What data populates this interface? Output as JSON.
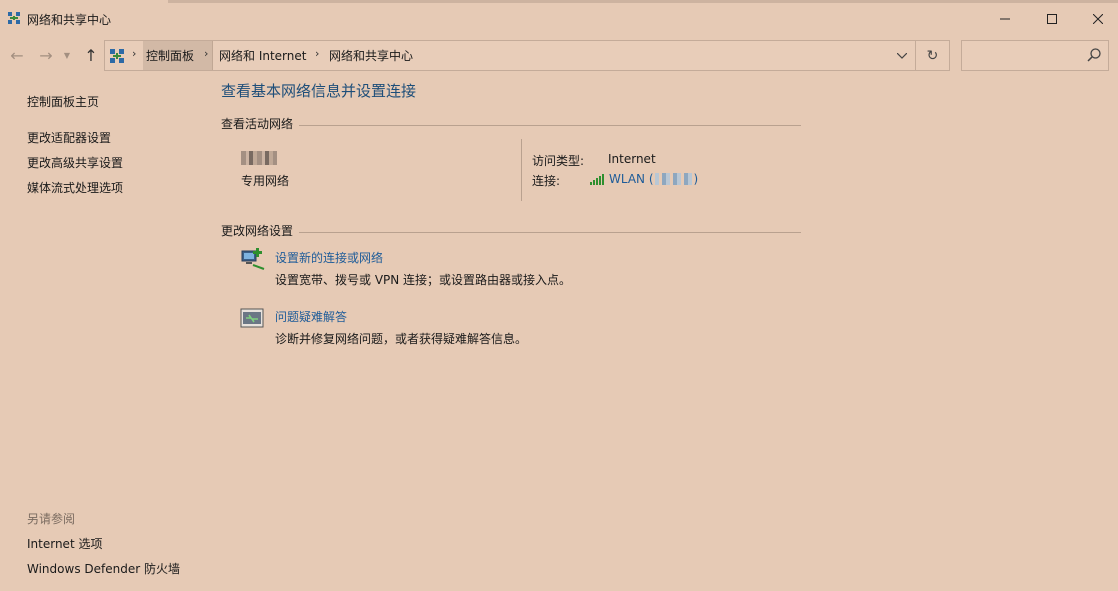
{
  "window": {
    "title": "网络和共享中心"
  },
  "nav": {
    "back_icon": "back-arrow-icon",
    "forward_icon": "forward-arrow-icon",
    "up_icon": "up-arrow-icon",
    "breadcrumbs": [
      "控制面板",
      "网络和 Internet",
      "网络和共享中心"
    ],
    "search_placeholder": ""
  },
  "sidebar": {
    "home": "控制面板主页",
    "items": [
      "更改适配器设置",
      "更改高级共享设置",
      "媒体流式处理选项"
    ],
    "see_also_label": "另请参阅",
    "see_also": [
      "Internet 选项",
      "Windows Defender 防火墙"
    ]
  },
  "main": {
    "title": "查看基本网络信息并设置连接",
    "active_section": "查看活动网络",
    "network_type": "专用网络",
    "access_type_label": "访问类型:",
    "access_type_value": "Internet",
    "connection_label": "连接:",
    "connection_prefix": "WLAN (",
    "connection_suffix": ")",
    "change_section": "更改网络设置",
    "tasks": [
      {
        "link": "设置新的连接或网络",
        "desc": "设置宽带、拨号或 VPN 连接；或设置路由器或接入点。"
      },
      {
        "link": "问题疑难解答",
        "desc": "诊断并修复网络问题，或者获得疑难解答信息。"
      }
    ]
  },
  "colors": {
    "background": "#e6cab5",
    "link": "#1e5c99",
    "title": "#1e4e79"
  }
}
